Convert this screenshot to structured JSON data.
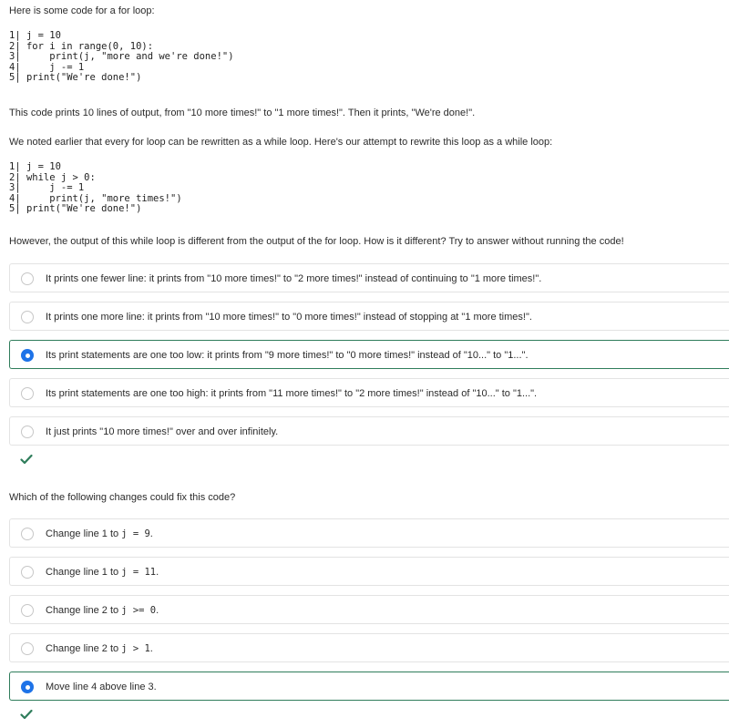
{
  "intro": "Here is some code for a for loop:",
  "code1": [
    "1| j = 10",
    "2| for i in range(0, 10):",
    "3|     print(j, \"more and we're done!\")",
    "4|     j -= 1",
    "5| print(\"We're done!\")"
  ],
  "explain": "This code prints 10 lines of output, from \"10 more times!\" to \"1 more times!\". Then it prints, \"We're done!\".",
  "rewrite": "We noted earlier that every for loop can be rewritten as a while loop. Here's our attempt to rewrite this loop as a while loop:",
  "code2": [
    "1| j = 10",
    "2| while j > 0:",
    "3|     j -= 1",
    "4|     print(j, \"more times!\")",
    "5| print(\"We're done!\")"
  ],
  "question1": "However, the output of this while loop is different from the output of the for loop. How is it different? Try to answer without running the code!",
  "q1_options": [
    {
      "label": "It prints one fewer line: it prints from \"10 more times!\" to \"2 more times!\" instead of continuing to \"1 more times!\".",
      "selected": false
    },
    {
      "label": "It prints one more line: it prints from \"10 more times!\" to \"0 more times!\" instead of stopping at \"1 more times!\".",
      "selected": false
    },
    {
      "label": "Its print statements are one too low: it prints from \"9 more times!\" to \"0 more times!\" instead of \"10...\" to \"1...\".",
      "selected": true
    },
    {
      "label": "Its print statements are one too high: it prints from \"11 more times!\" to \"2 more times!\" instead of \"10...\" to \"1...\".",
      "selected": false
    },
    {
      "label": "It just prints \"10 more times!\" over and over infinitely.",
      "selected": false
    }
  ],
  "question2": "Which of the following changes could fix this code?",
  "q2_options": [
    {
      "prefix": "Change line 1 to ",
      "code": "j = 9",
      "suffix": ".",
      "selected": false
    },
    {
      "prefix": "Change line 1 to ",
      "code": "j = 11",
      "suffix": ".",
      "selected": false
    },
    {
      "prefix": "Change line 2 to ",
      "code": "j >= 0",
      "suffix": ".",
      "selected": false
    },
    {
      "prefix": "Change line 2 to ",
      "code": "j > 1",
      "suffix": ".",
      "selected": false
    },
    {
      "prefix": "Move line 4 above line 3.",
      "code": "",
      "suffix": "",
      "selected": true
    }
  ],
  "colors": {
    "selected_border": "#2f7d5b",
    "radio_selected": "#1e73e8",
    "check": "#2f7d5b"
  },
  "icons": {
    "correct": "checkmark-icon"
  }
}
